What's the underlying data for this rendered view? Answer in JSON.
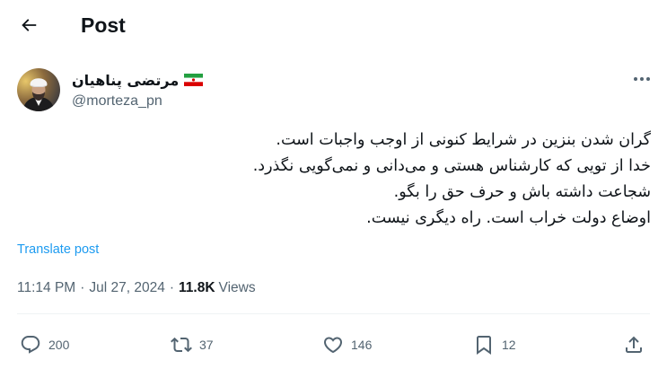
{
  "header": {
    "title": "Post"
  },
  "author": {
    "display_name": "مرتضی پناهیان",
    "handle": "@morteza_pn"
  },
  "tweet": {
    "lines": [
      "گران شدن بنزین در شرایط کنونی از اوجب واجبات است.",
      "خدا از تویی که کارشناس هستی و می‌دانی و نمی‌گویی نگذرد.",
      "شجاعت داشته باش و حرف حق را بگو.",
      "اوضاع دولت خراب است. راه دیگری نیست."
    ],
    "translate_label": "Translate post"
  },
  "meta": {
    "time": "11:14 PM",
    "date": "Jul 27, 2024",
    "views_count": "11.8K",
    "views_label": "Views",
    "separator": "·"
  },
  "actions": {
    "replies": "200",
    "reposts": "37",
    "likes": "146",
    "bookmarks": "12"
  },
  "colors": {
    "text": "#0f1419",
    "secondary": "#536471",
    "link": "#1d9bf0",
    "divider": "#eff3f4"
  }
}
